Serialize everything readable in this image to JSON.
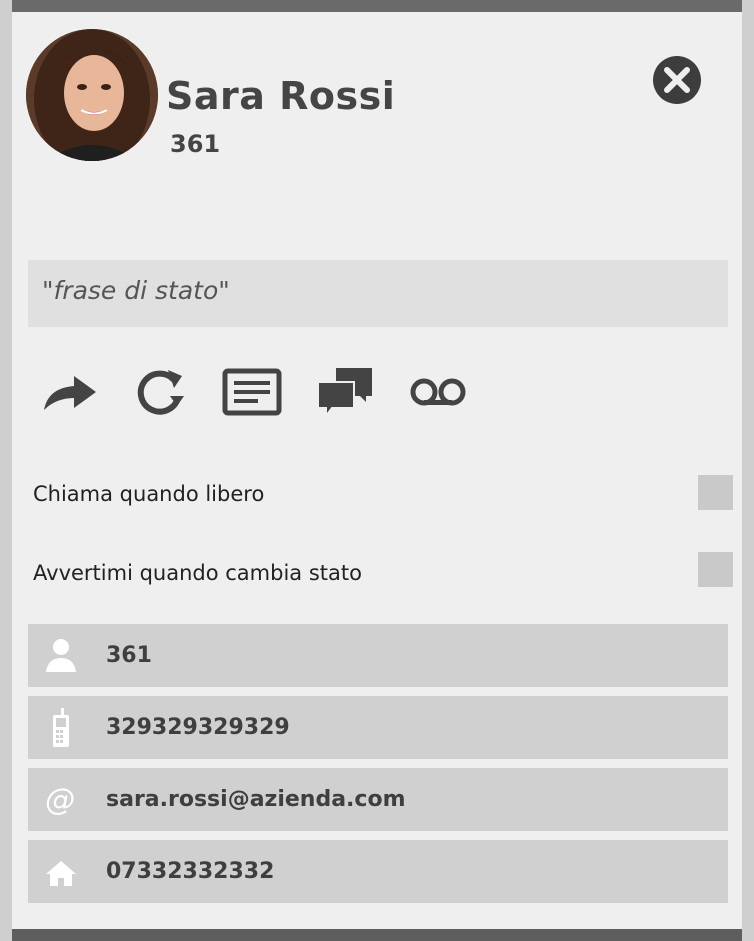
{
  "contact": {
    "name": "Sara Rossi",
    "extension": "361",
    "status_phrase": "\"frase di stato\""
  },
  "icons": {
    "close": "close-icon",
    "actions": [
      "forward-icon",
      "refresh-icon",
      "message-icon",
      "chat-icon",
      "voicemail-icon"
    ],
    "info": [
      "user-icon",
      "mobile-phone-icon",
      "at-icon",
      "home-icon"
    ]
  },
  "options": {
    "call_when_free": "Chiama quando libero",
    "notify_status_change": "Avvertimi quando cambia stato"
  },
  "info": {
    "internal": "361",
    "mobile": "329329329329",
    "email": "sara.rossi@azienda.com",
    "home": "07332332332"
  },
  "colors": {
    "overlay": "#5e5e5e",
    "panel": "#efefef",
    "status_box": "#e0e0e0",
    "info_row": "#d0d0d0",
    "icon_dark": "#3f3f3f"
  }
}
